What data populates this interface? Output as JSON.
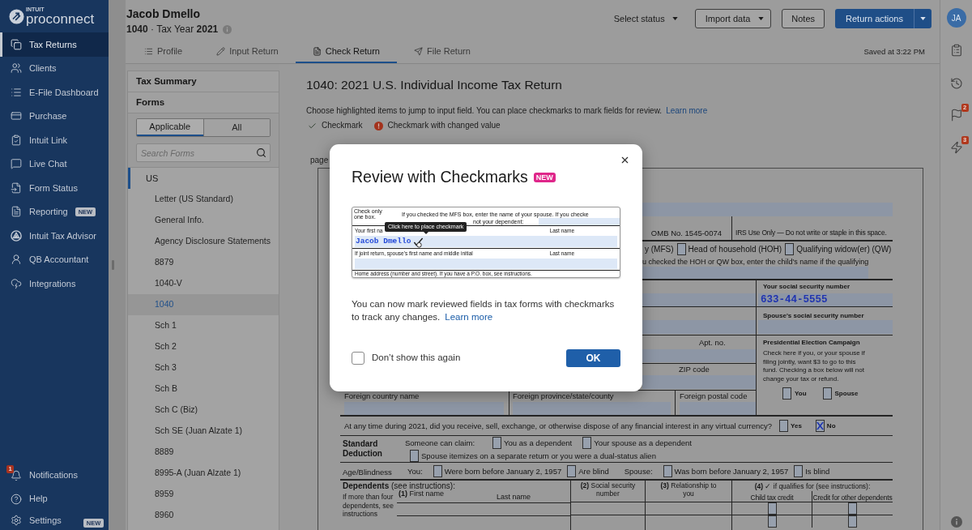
{
  "sidebar": {
    "logo": {
      "company": "INTUIT",
      "product": "proconnect"
    },
    "items": [
      {
        "label": "Tax Returns",
        "selected": true
      },
      {
        "label": "Clients",
        "selected": false
      },
      {
        "label": "E-File Dashboard",
        "selected": false
      },
      {
        "label": "Purchase",
        "selected": false
      },
      {
        "label": "Intuit Link",
        "selected": false
      },
      {
        "label": "Live Chat",
        "selected": false
      },
      {
        "label": "Form Status",
        "selected": false
      },
      {
        "label": "Reporting",
        "selected": false,
        "badge": "NEW"
      },
      {
        "label": "Intuit Tax Advisor",
        "selected": false
      },
      {
        "label": "QB Accountant",
        "selected": false
      },
      {
        "label": "Integrations",
        "selected": false
      }
    ],
    "bottom_items": [
      {
        "label": "Notifications",
        "count": "1"
      },
      {
        "label": "Help"
      },
      {
        "label": "Settings",
        "badge": "NEW"
      }
    ]
  },
  "header": {
    "client_name": "Jacob Dmello",
    "return_info": "**1040** · Tax Year **2021**",
    "status_select": "Select status",
    "actions": [
      {
        "label": "Import data",
        "kind": "split"
      },
      {
        "label": "Notes",
        "kind": "plain"
      },
      {
        "label": "Return actions",
        "kind": "primary-split"
      }
    ],
    "tabs": [
      {
        "label": "Profile",
        "selected": false
      },
      {
        "label": "Input Return",
        "selected": false
      },
      {
        "label": "Check Return",
        "selected": true
      },
      {
        "label": "File Return",
        "selected": false
      }
    ],
    "saved_status": "Saved at 3:22 PM"
  },
  "right_rail": {
    "avatar_initials": "JA",
    "flag_badge": "2",
    "lightning_badge": "3"
  },
  "forms_panel": {
    "sections": [
      "Tax Summary",
      "Forms"
    ],
    "filter_tabs": [
      {
        "label": "Applicable",
        "selected": true
      },
      {
        "label": "All",
        "selected": false
      }
    ],
    "search": {
      "placeholder": "Search Forms"
    },
    "tree": [
      {
        "label": "US",
        "active": true,
        "children": [
          {
            "label": "Letter (US Standard)",
            "selected": false
          },
          {
            "label": "General Info.",
            "selected": false
          },
          {
            "label": "Agency Disclosure Statements",
            "selected": false
          },
          {
            "label": "8879",
            "selected": false
          },
          {
            "label": "1040-V",
            "selected": false
          },
          {
            "label": "1040",
            "selected": true
          },
          {
            "label": "Sch 1",
            "selected": false
          },
          {
            "label": "Sch 2",
            "selected": false
          },
          {
            "label": "Sch 3",
            "selected": false
          },
          {
            "label": "Sch B",
            "selected": false
          },
          {
            "label": "Sch C (Biz)",
            "selected": false
          },
          {
            "label": "Sch SE (Juan Alzate 1)",
            "selected": false
          },
          {
            "label": "8889",
            "selected": false
          },
          {
            "label": "8995-A (Juan Alzate 1)",
            "selected": false
          },
          {
            "label": "8959",
            "selected": false
          },
          {
            "label": "8960",
            "selected": false
          }
        ]
      }
    ]
  },
  "content": {
    "title": "1040: 2021 U.S. Individual Income Tax Return",
    "instructions": "Choose highlighted items to jump to input field. You can place checkmarks to mark fields for review.",
    "instructions_link": "Learn more",
    "legend": [
      {
        "label": "Checkmark",
        "kind": "check"
      },
      {
        "label": "Checkmark with changed value",
        "kind": "changed"
      }
    ],
    "page_label": "page",
    "form": {
      "omb": "OMB No. 1545-0074",
      "irs_use": "IRS Use Only — Do not write or staple in this space.",
      "filing_status": [
        {
          "kind": "tail",
          "label": "y (MFS)"
        },
        {
          "kind": "option",
          "label": "Head of household (HOH)",
          "checked": false
        },
        {
          "kind": "option",
          "label": "Qualifying widow(er) (QW)",
          "checked": false
        }
      ],
      "qualifying_note": "u checked the HOH or QW box, enter the child's name if the qualifying",
      "apt_label": "Apt. no.",
      "zip_label": "ZIP code",
      "ssn": {
        "label": "Your social security number",
        "value": "633-44-5555"
      },
      "spouse_ssn": {
        "label": "Spouse's social security number"
      },
      "foreign": [
        "Foreign country name",
        "Foreign province/state/county",
        "Foreign postal code"
      ],
      "presidential": {
        "title": "Presidential Election Campaign",
        "text": "Check here if you, or your spouse if filing jointly, want $3 to go to this fund. Checking a box below will not change your tax or refund.",
        "options": [
          {
            "label": "You",
            "checked": false
          },
          {
            "label": "Spouse",
            "checked": false
          }
        ]
      },
      "virtual_currency": {
        "question": "At any time during 2021, did you receive, sell, exchange, or otherwise dispose of any financial interest in any virtual currency?",
        "options": [
          {
            "label": "Yes",
            "checked": false
          },
          {
            "label": "No",
            "checked": true
          }
        ]
      },
      "standard_deduction": {
        "title": "Standard Deduction",
        "claim_label": "Someone can claim:",
        "options": [
          {
            "label": "You as a dependent",
            "checked": false
          },
          {
            "label": "Your spouse as a dependent",
            "checked": false
          },
          {
            "label": "Spouse itemizes on a separate return or you were a dual-status alien",
            "checked": false
          }
        ]
      },
      "age_blindness": {
        "title": "Age/Blindness",
        "groups": [
          {
            "label": "You:",
            "options": [
              {
                "label": "Were born before January 2, 1957",
                "checked": false
              },
              {
                "label": "Are blind",
                "checked": false
              }
            ]
          },
          {
            "label": "Spouse:",
            "options": [
              {
                "label": "Was born before January 2, 1957",
                "checked": false
              },
              {
                "label": "Is blind",
                "checked": false
              }
            ]
          }
        ]
      },
      "dependents": {
        "title": "**Dependents** (see instructions):",
        "side_note": "If more than four dependents, see instructions",
        "first_name": "**(1)** First name",
        "last_name": "Last name",
        "ssn": "**(2)** Social security number",
        "relationship": "**(3)** Relationship to you",
        "qualifies": "**(4)** ✓ if qualifies for (see instructions):",
        "credit_columns": [
          "Child tax credit",
          "Credit for other dependents"
        ],
        "rows": [
          {
            "child_tax_credit": false,
            "other_dependents_credit": false
          },
          {
            "child_tax_credit": false,
            "other_dependents_credit": false
          }
        ]
      }
    }
  },
  "dialog": {
    "title": "Review with Checkmarks",
    "badge": "NEW",
    "preview": {
      "check_only": "Check only one box.",
      "mfs_note": "If you checked the MFS box, enter the name of your spouse. If you checke",
      "dependent_note": "not your dependent:",
      "first_name_label": "Your first na",
      "last_name_label": "Last name",
      "name_value": "Jacob Dmello",
      "tooltip": "Click here to place checkmark",
      "spouse_label": "If joint return, spouse's first name and middle initial",
      "spouse_last_label": "Last name",
      "address_label": "Home address (number and street). If you have a P.O. box, see instructions."
    },
    "message": "You can now mark reviewed fields in tax forms with checkmarks to track any changes.",
    "link": "Learn more",
    "dont_show": {
      "label": "Don’t show this again",
      "checked": false
    },
    "ok": "OK"
  }
}
